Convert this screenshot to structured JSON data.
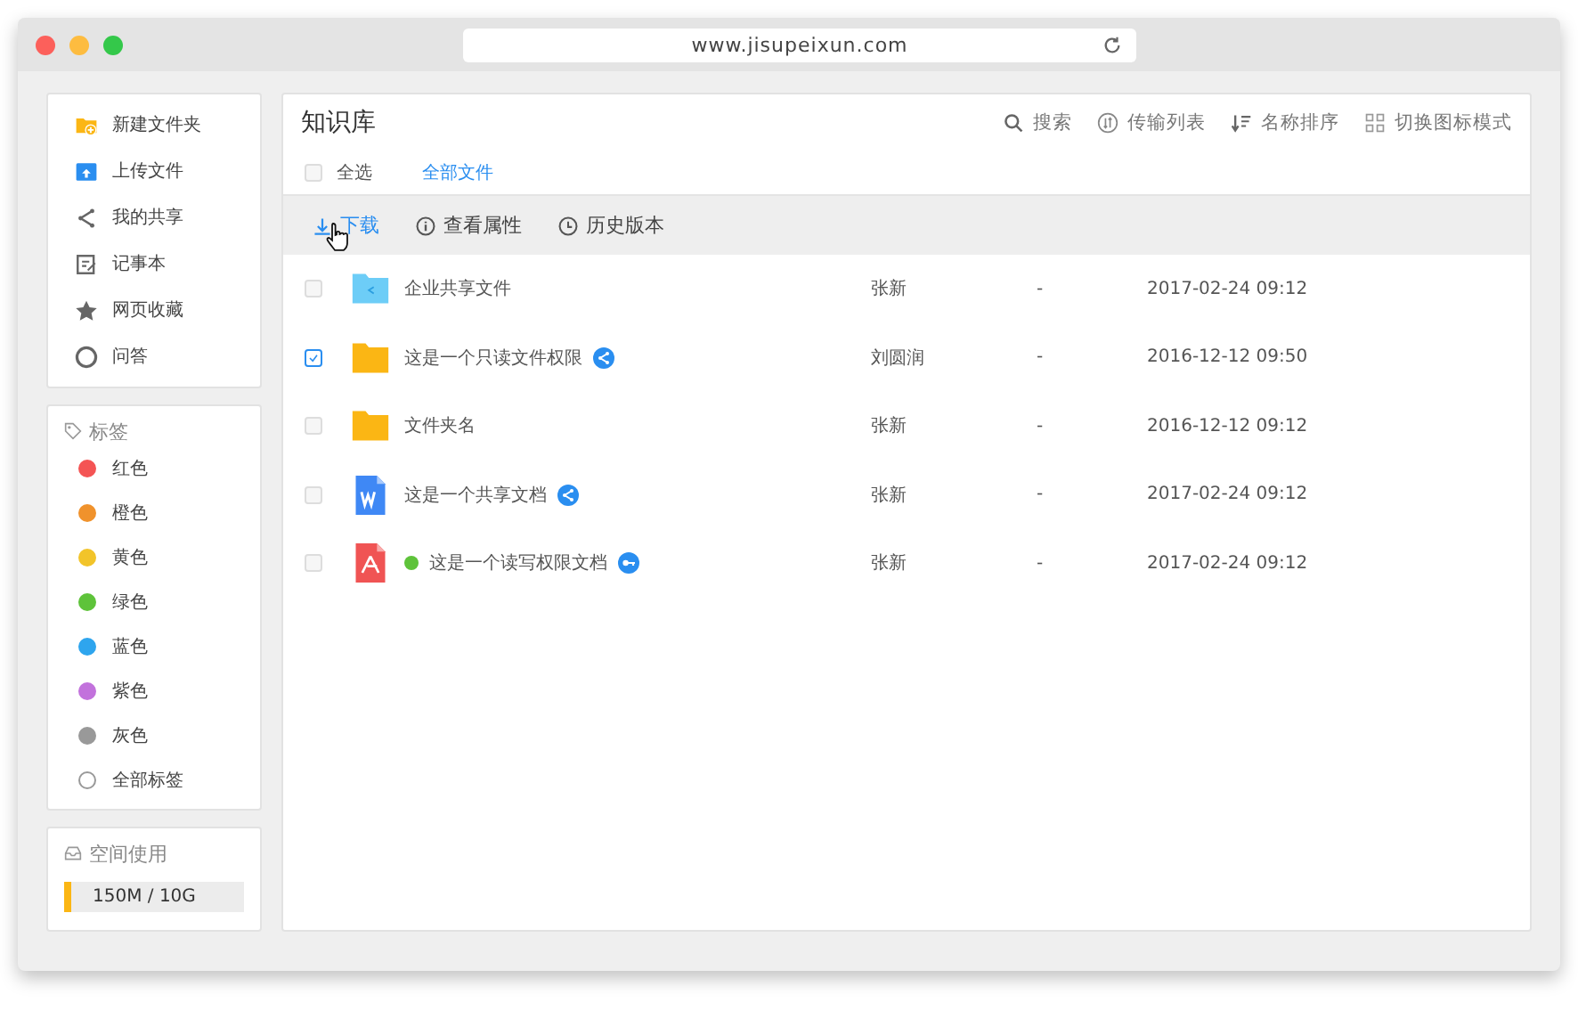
{
  "window": {
    "url": "www.jisupeixun.com"
  },
  "sidebar": {
    "actions": [
      {
        "label": "新建文件夹",
        "kind": "new-folder"
      },
      {
        "label": "上传文件",
        "kind": "upload"
      },
      {
        "label": "我的共享",
        "kind": "share"
      },
      {
        "label": "记事本",
        "kind": "notepad"
      },
      {
        "label": "网页收藏",
        "kind": "star"
      },
      {
        "label": "问答",
        "kind": "chat"
      }
    ],
    "tags": {
      "title": "标签",
      "items": [
        {
          "label": "红色",
          "color": "#f45454"
        },
        {
          "label": "橙色",
          "color": "#f0922c"
        },
        {
          "label": "黄色",
          "color": "#f2c42a"
        },
        {
          "label": "绿色",
          "color": "#5ec33a"
        },
        {
          "label": "蓝色",
          "color": "#2ea5ee"
        },
        {
          "label": "紫色",
          "color": "#c272dc"
        },
        {
          "label": "灰色",
          "color": "#999999"
        },
        {
          "label": "全部标签"
        }
      ]
    },
    "storage": {
      "title": "空间使用",
      "level": 0.03,
      "reading": "150M / 10G"
    }
  },
  "main": {
    "title": "知识库",
    "tools": [
      {
        "label": "搜索",
        "kind": "search"
      },
      {
        "label": "传输列表",
        "kind": "transfer"
      },
      {
        "label": "名称排序",
        "kind": "sort"
      },
      {
        "label": "切换图标模式",
        "kind": "grid"
      }
    ],
    "select_all": {
      "label": "全选",
      "checked": false
    },
    "breadcrumb": "全部文件",
    "actions": [
      {
        "label": "下载",
        "kind": "download",
        "selected": true
      },
      {
        "label": "查看属性",
        "kind": "info",
        "selected": false
      },
      {
        "label": "历史版本",
        "kind": "history",
        "selected": false
      }
    ],
    "rows": [
      {
        "checked": false,
        "kind": "shared-folder",
        "name": "企业共享文件",
        "owner": "张新",
        "size": "-",
        "modified": "2017-02-24 09:12"
      },
      {
        "checked": true,
        "kind": "folder",
        "name": "这是一个只读文件权限",
        "badge": {
          "kind": "share"
        },
        "owner": "刘圆润",
        "size": "-",
        "modified": "2016-12-12 09:50"
      },
      {
        "checked": false,
        "kind": "folder",
        "name": "文件夹名",
        "owner": "张新",
        "size": "-",
        "modified": "2016-12-12 09:12"
      },
      {
        "checked": false,
        "kind": "word",
        "name": "这是一个共享文档",
        "badge": {
          "kind": "share"
        },
        "owner": "张新",
        "size": "-",
        "modified": "2017-02-24 09:12"
      },
      {
        "checked": false,
        "kind": "pdf",
        "name": "这是一个读写权限文档",
        "badge": {
          "kind": "key"
        },
        "tag": {
          "color": "#5ec33a"
        },
        "owner": "张新",
        "size": "-",
        "modified": "2017-02-24 09:12"
      }
    ]
  }
}
